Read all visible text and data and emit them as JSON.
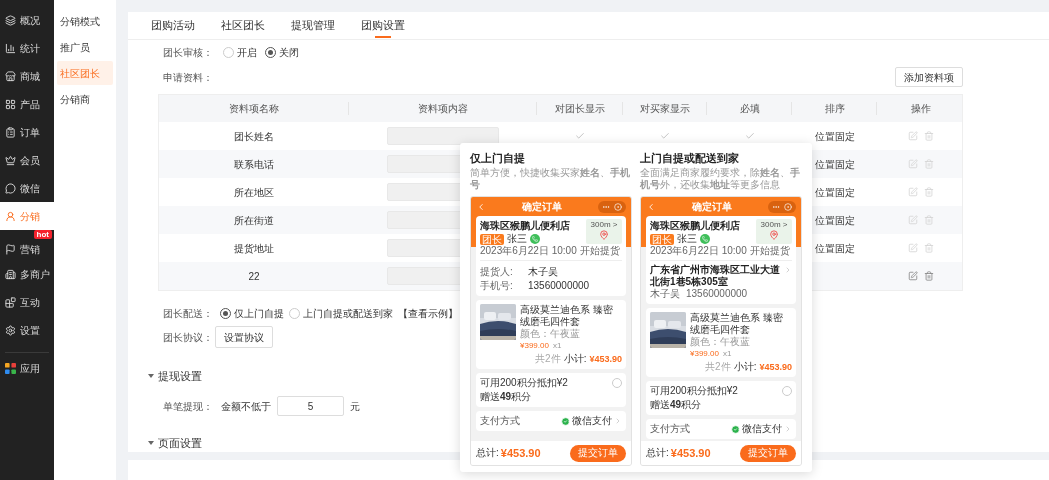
{
  "sidebar": {
    "items": [
      {
        "label": "概况",
        "selected": false
      },
      {
        "label": "统计",
        "selected": false
      },
      {
        "label": "商城",
        "selected": false
      },
      {
        "label": "产品",
        "selected": false
      },
      {
        "label": "订单",
        "selected": false
      },
      {
        "label": "会员",
        "selected": false
      },
      {
        "label": "微信",
        "selected": false
      },
      {
        "label": "分销",
        "selected": true
      },
      {
        "label": "营销",
        "selected": false,
        "badge": "hot"
      },
      {
        "label": "多商户",
        "selected": false
      },
      {
        "label": "互动",
        "selected": false
      },
      {
        "label": "设置",
        "selected": false
      }
    ],
    "apps": [
      {
        "label": "应用",
        "selected": false
      }
    ]
  },
  "submenu": {
    "items": [
      {
        "label": "分销模式",
        "selected": false
      },
      {
        "label": "推广员",
        "selected": false
      },
      {
        "label": "社区团长",
        "selected": true
      },
      {
        "label": "分销商",
        "selected": false
      }
    ]
  },
  "tabs": [
    {
      "label": "团购活动",
      "selected": false
    },
    {
      "label": "社区团长",
      "selected": false
    },
    {
      "label": "提现管理",
      "selected": false
    },
    {
      "label": "团购设置",
      "selected": true
    }
  ],
  "leader_review": {
    "label": "团长审核：",
    "options": [
      {
        "label": "开启",
        "selected": false
      },
      {
        "label": "关闭",
        "selected": true
      }
    ]
  },
  "application": {
    "label": "申请资料：",
    "add_button": "添加资料项"
  },
  "table": {
    "columns": [
      "资料项名称",
      "资料项内容",
      "对团长显示",
      "对买家显示",
      "必填",
      "排序",
      "操作"
    ],
    "rows": [
      {
        "name": "团长姓名",
        "checks": [
          true,
          true,
          true
        ],
        "sort": "位置固定",
        "actions_enabled": false
      },
      {
        "name": "联系电话",
        "sort": "位置固定",
        "actions_enabled": false
      },
      {
        "name": "所在地区",
        "sort": "位置固定",
        "actions_enabled": false
      },
      {
        "name": "所在街道",
        "sort": "位置固定",
        "actions_enabled": false
      },
      {
        "name": "提货地址",
        "sort": "位置固定",
        "actions_enabled": false
      },
      {
        "name": "22",
        "actions_enabled": true
      }
    ]
  },
  "delivery": {
    "label": "团长配送：",
    "options": [
      {
        "label": "仅上门自提",
        "selected": true
      },
      {
        "label": "上门自提或配送到家",
        "selected": false
      }
    ],
    "example_link": "【查看示例】"
  },
  "agreement": {
    "label": "团长协议：",
    "button": "设置协议"
  },
  "withdraw_section": {
    "title": "提现设置",
    "expanded": true,
    "label": "单笔提现：",
    "prefix": "金额不低于",
    "value": "5",
    "unit": "元"
  },
  "page_section": {
    "title": "页面设置",
    "expanded": true
  },
  "example_popup": {
    "options": [
      {
        "title": "仅上门自提",
        "description": "简单方便，快捷收集买家**姓名**、**手机号**",
        "phone": {
          "kind": "pickup",
          "header_title": "确定订单",
          "store": "海珠区猴鹏儿便利店",
          "tag": "团长",
          "leader": "张三",
          "date": "2023年6月22日 10:00 开始提货",
          "distance": "300m >",
          "contacts": [
            {
              "label": "提货人:",
              "value": "木子吴"
            },
            {
              "label": "手机号:",
              "value": "13560000000"
            }
          ],
          "product": "高级莫兰迪色系 臻密绒磨毛四件套",
          "spec": "颜色：午夜蓝",
          "price": "¥399.00",
          "qty": "x1",
          "count": "共2件",
          "subtotal_label": "小计:",
          "subtotal": "¥453.90",
          "points": "可用200积分抵扣¥2",
          "points_selected": false,
          "gift": "赠送**49**积分",
          "pay_label": "支付方式",
          "pay": "微信支付",
          "total_label": "总计:",
          "total": "¥453.90",
          "submit": "提交订单"
        }
      },
      {
        "title": "上门自提或配送到家",
        "description": "全面满足商家履约要求，除**姓名**、**手机号**外，还收集**地址**等更多信息",
        "phone": {
          "kind": "delivery",
          "header_title": "确定订单",
          "store": "海珠区猴鹏儿便利店",
          "tag": "团长",
          "leader": "张三",
          "date": "2023年6月22日 10:00 开始提货",
          "distance": "300m >",
          "address": "广东省广州市海珠区工业大道北街1巷5栋305室",
          "receiver": "木子吴",
          "receiver_phone": "13560000000",
          "product": "高级莫兰迪色系 臻密绒磨毛四件套",
          "spec": "颜色：午夜蓝",
          "price": "¥399.00",
          "qty": "x1",
          "count": "共2件",
          "subtotal_label": "小计:",
          "subtotal": "¥453.90",
          "points": "可用200积分抵扣¥2",
          "points_selected": false,
          "gift": "赠送**49**积分",
          "pay_label": "支付方式",
          "pay": "微信支付",
          "total_label": "总计:",
          "total": "¥453.90",
          "submit": "提交订单"
        }
      }
    ]
  }
}
